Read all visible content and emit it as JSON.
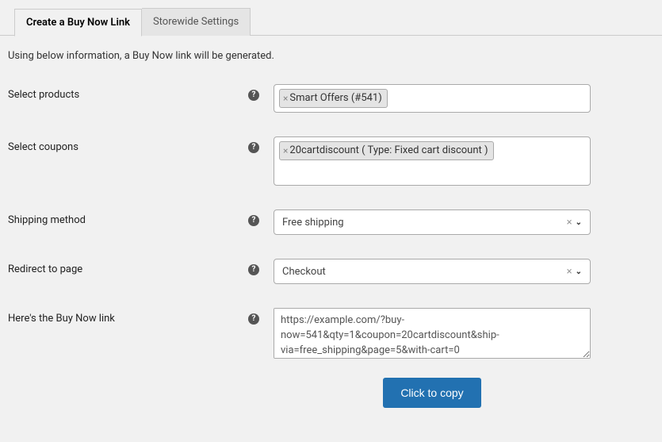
{
  "tabs": {
    "create": "Create a Buy Now Link",
    "storewide": "Storewide Settings"
  },
  "intro": "Using below information, a Buy Now link will be generated.",
  "labels": {
    "products": "Select products",
    "coupons": "Select coupons",
    "shipping": "Shipping method",
    "redirect": "Redirect to page",
    "link": "Here's the Buy Now link"
  },
  "values": {
    "product_tag": "Smart Offers (#541)",
    "coupon_tag": "20cartdiscount ( Type: Fixed cart discount )",
    "shipping": "Free shipping",
    "redirect": "Checkout",
    "generated_link": "https://example.com/?buy-now=541&qty=1&coupon=20cartdiscount&ship-via=free_shipping&page=5&with-cart=0"
  },
  "buttons": {
    "copy": "Click to copy"
  },
  "help_icon_char": "?"
}
